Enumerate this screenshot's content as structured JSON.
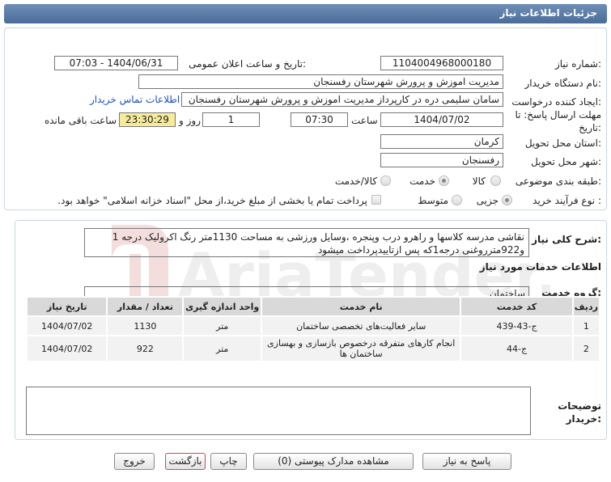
{
  "header": {
    "title": "جزئیات اطلاعات نیاز"
  },
  "form": {
    "need_number_label": "شماره نیاز:",
    "need_number": "1104004968000180",
    "announce_label": "تاریخ و ساعت اعلان عمومی:",
    "announce_value": "1404/06/31 - 07:03",
    "buyer_org_label": "نام دستگاه خریدار:",
    "buyer_org": "مدیریت اموزش و پرورش شهرستان رفسنجان",
    "creator_label": "ایجاد کننده درخواست:",
    "creator": "سامان سلیمی دره در کارپرداز مدیریت اموزش و پرورش شهرستان رفسنجان",
    "contact_link": "اطلاعات تماس خریدار",
    "deadline_label": "مهلت ارسال پاسخ: تا تاریخ:",
    "deadline_date": "1404/07/02",
    "time_label": "ساعت",
    "deadline_time": "07:30",
    "days_value": "1",
    "days_label": "روز و",
    "remaining_time": "23:30:29",
    "remaining_label": "ساعت باقی مانده",
    "province_label": "استان محل تحویل:",
    "province": "کرمان",
    "city_label": "شهر محل تحویل:",
    "city": "رفسنجان",
    "category_label": "طبقه بندی موضوعی:",
    "category_options": [
      "کالا",
      "خدمت",
      "کالا/خدمت"
    ],
    "category_selected": "خدمت",
    "process_label": "نوع فرآیند خرید :",
    "process_options": [
      "جزیی",
      "متوسط"
    ],
    "process_selected": "جزیی",
    "payment_note": "پرداخت تمام یا بخشی از مبلغ خرید،از محل \"اسناد خزانه اسلامی\" خواهد بود."
  },
  "description": {
    "label": "شرح کلی نیاز:",
    "text": "نقاشی مدرسه کلاسها و راهرو درب وپنجره ،وسایل ورزشی به مساحت 1130متر رنگ اکرولیک درجه 1 و922مترروغنی درجه1که پس ازتاییدپرداخت میشود"
  },
  "services": {
    "section_title": "اطلاعات خدمات مورد نیاز",
    "group_label": "گروه خدمت:",
    "group_value": "ساختمان",
    "columns": [
      "ردیف",
      "کد خدمت",
      "نام خدمت",
      "واحد اندازه گیری",
      "تعداد / مقدار",
      "تاریخ نیاز"
    ],
    "rows": [
      [
        "1",
        "ج-43-439",
        "سایر فعالیت‌های تخصصی ساختمان",
        "متر",
        "1130",
        "1404/07/02"
      ],
      [
        "2",
        "ج-44",
        "انجام کارهای متفرقه درخصوص بازسازی و بهسازی ساختمان ها",
        "متر",
        "922",
        "1404/07/02"
      ]
    ]
  },
  "notes": {
    "label": "توضیحات خریدار:",
    "value": ""
  },
  "buttons": {
    "reply": "پاسخ به نیاز",
    "attachments": "مشاهده مدارک پیوستی (0)",
    "print": "چاپ",
    "back": "بازگشت",
    "exit": "خروج"
  },
  "watermark": {
    "text": "AriaTender.net"
  },
  "colors": {
    "header": "#5a7aa6",
    "remaining_bg": "#f5eb9a",
    "link": "#1f4fbf",
    "exit_border": "#d04a4a"
  }
}
